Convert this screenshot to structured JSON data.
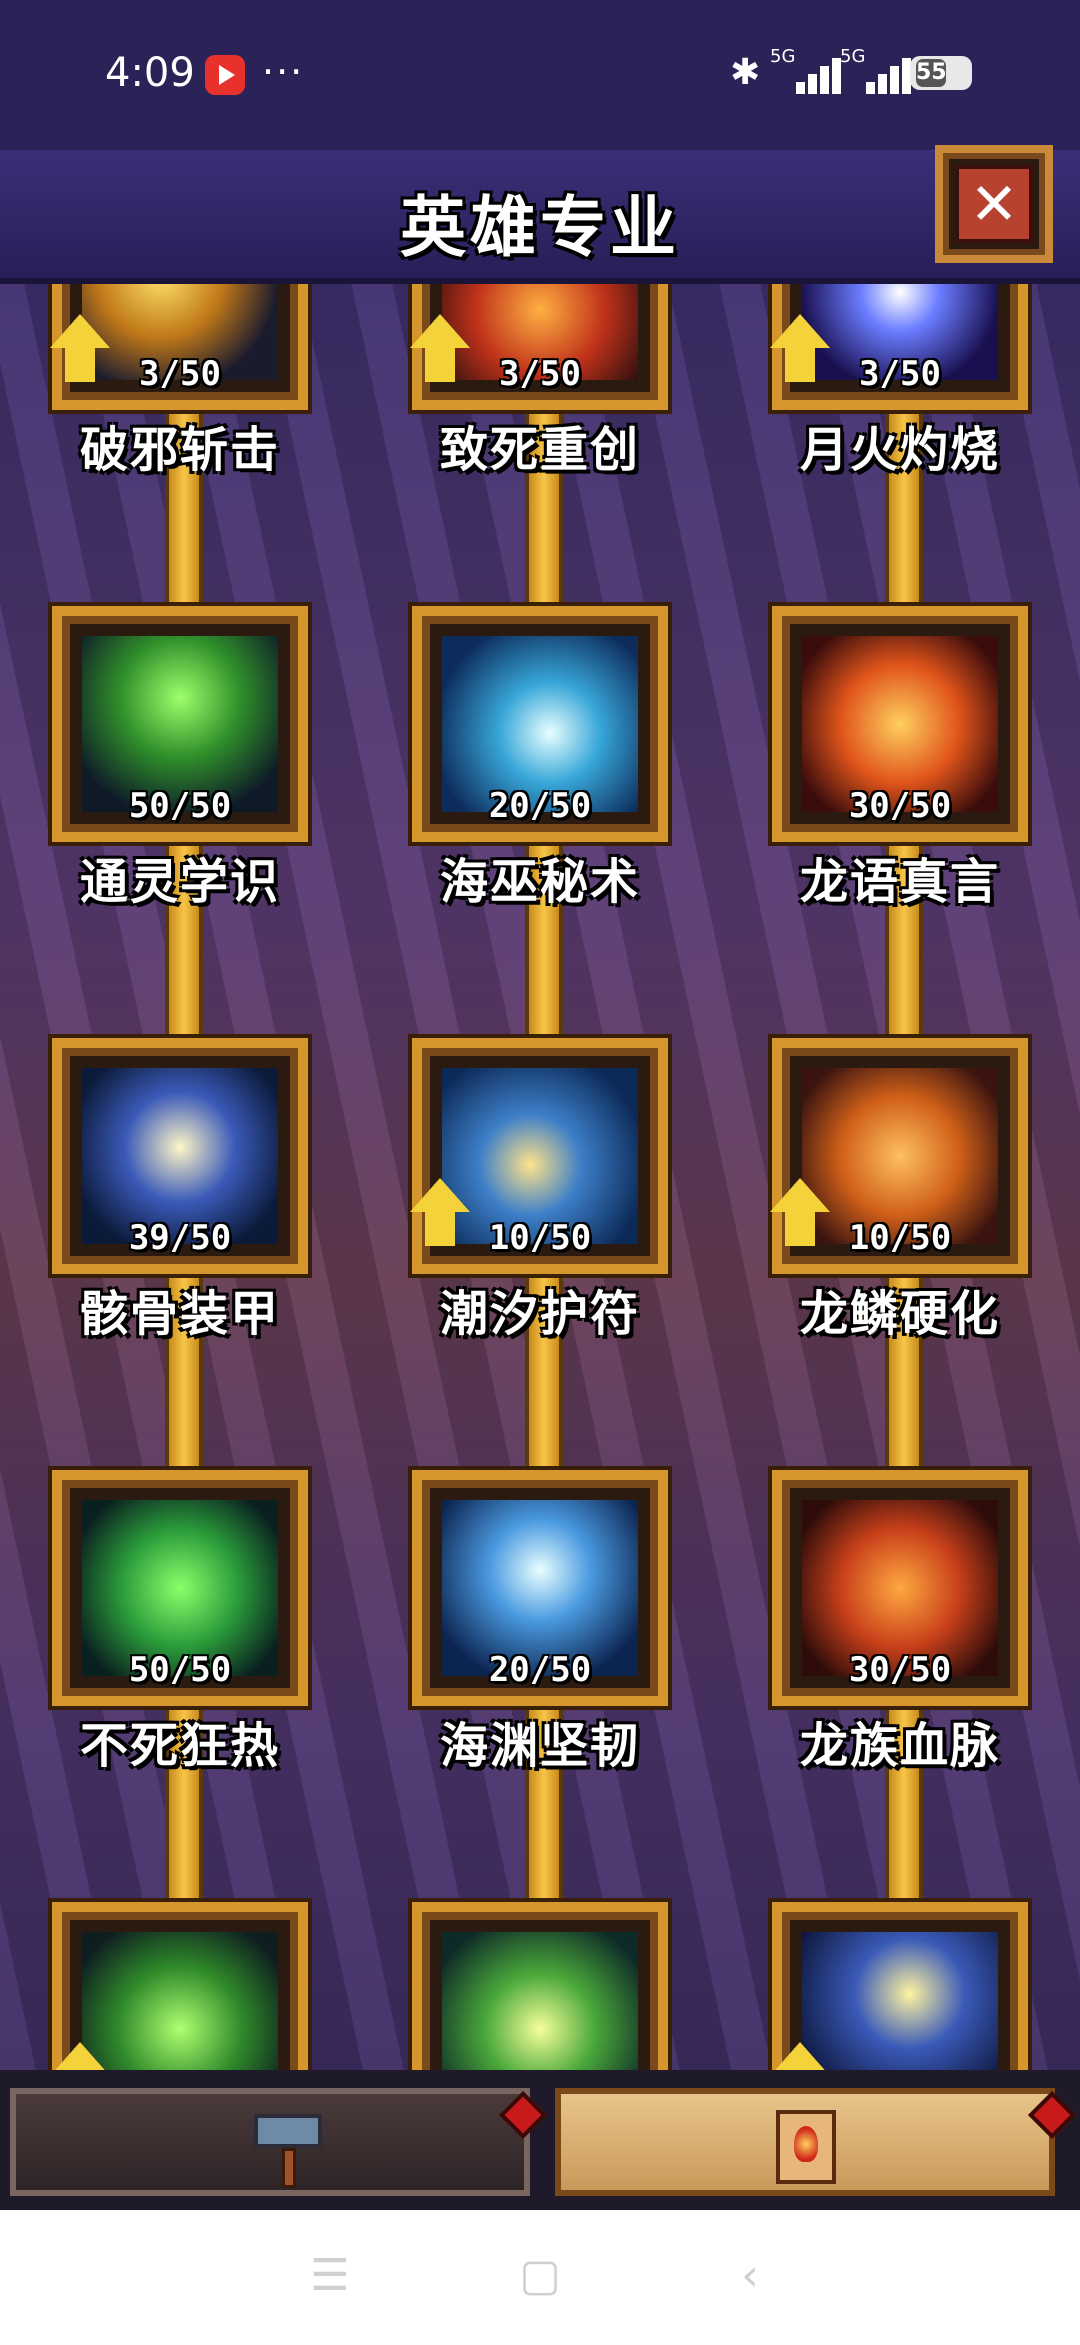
{
  "status_bar": {
    "time": "4:09",
    "dots": "···",
    "network1": "5G",
    "network2": "5G",
    "battery": "55"
  },
  "header": {
    "title": "英雄专业",
    "close_label": "✕"
  },
  "skills": [
    {
      "row": 0,
      "col": 0,
      "name": "破邪斩击",
      "level": "3/50",
      "theme": "golden",
      "upgrade": true
    },
    {
      "row": 0,
      "col": 1,
      "name": "致死重创",
      "level": "3/50",
      "theme": "fire",
      "upgrade": true
    },
    {
      "row": 0,
      "col": 2,
      "name": "月火灼烧",
      "level": "3/50",
      "theme": "moon",
      "upgrade": true
    },
    {
      "row": 1,
      "col": 0,
      "name": "通灵学识",
      "level": "50/50",
      "theme": "necro",
      "upgrade": false
    },
    {
      "row": 1,
      "col": 1,
      "name": "海巫秘术",
      "level": "20/50",
      "theme": "water",
      "upgrade": false
    },
    {
      "row": 1,
      "col": 2,
      "name": "龙语真言",
      "level": "30/50",
      "theme": "dragon",
      "upgrade": false
    },
    {
      "row": 2,
      "col": 0,
      "name": "骸骨装甲",
      "level": "39/50",
      "theme": "skull",
      "upgrade": false
    },
    {
      "row": 2,
      "col": 1,
      "name": "潮汐护符",
      "level": "10/50",
      "theme": "tide",
      "upgrade": true
    },
    {
      "row": 2,
      "col": 2,
      "name": "龙鳞硬化",
      "level": "10/50",
      "theme": "scale",
      "upgrade": true
    },
    {
      "row": 3,
      "col": 0,
      "name": "不死狂热",
      "level": "50/50",
      "theme": "spire",
      "upgrade": false
    },
    {
      "row": 3,
      "col": 1,
      "name": "海渊坚韧",
      "level": "20/50",
      "theme": "abyss",
      "upgrade": false
    },
    {
      "row": 3,
      "col": 2,
      "name": "龙族血脉",
      "level": "30/50",
      "theme": "blood",
      "upgrade": false
    },
    {
      "row": 4,
      "col": 0,
      "name": "",
      "level": "",
      "theme": "toxic",
      "upgrade": true
    },
    {
      "row": 4,
      "col": 1,
      "name": "",
      "level": "",
      "theme": "forest",
      "upgrade": false
    },
    {
      "row": 4,
      "col": 2,
      "name": "",
      "level": "",
      "theme": "star",
      "upgrade": true
    }
  ],
  "tabs": [
    {
      "icon": "hammer-icon",
      "active": false
    },
    {
      "icon": "scroll-icon",
      "active": true
    }
  ],
  "navbar": {
    "menu": "☰",
    "home": "▢",
    "back": "‹"
  }
}
